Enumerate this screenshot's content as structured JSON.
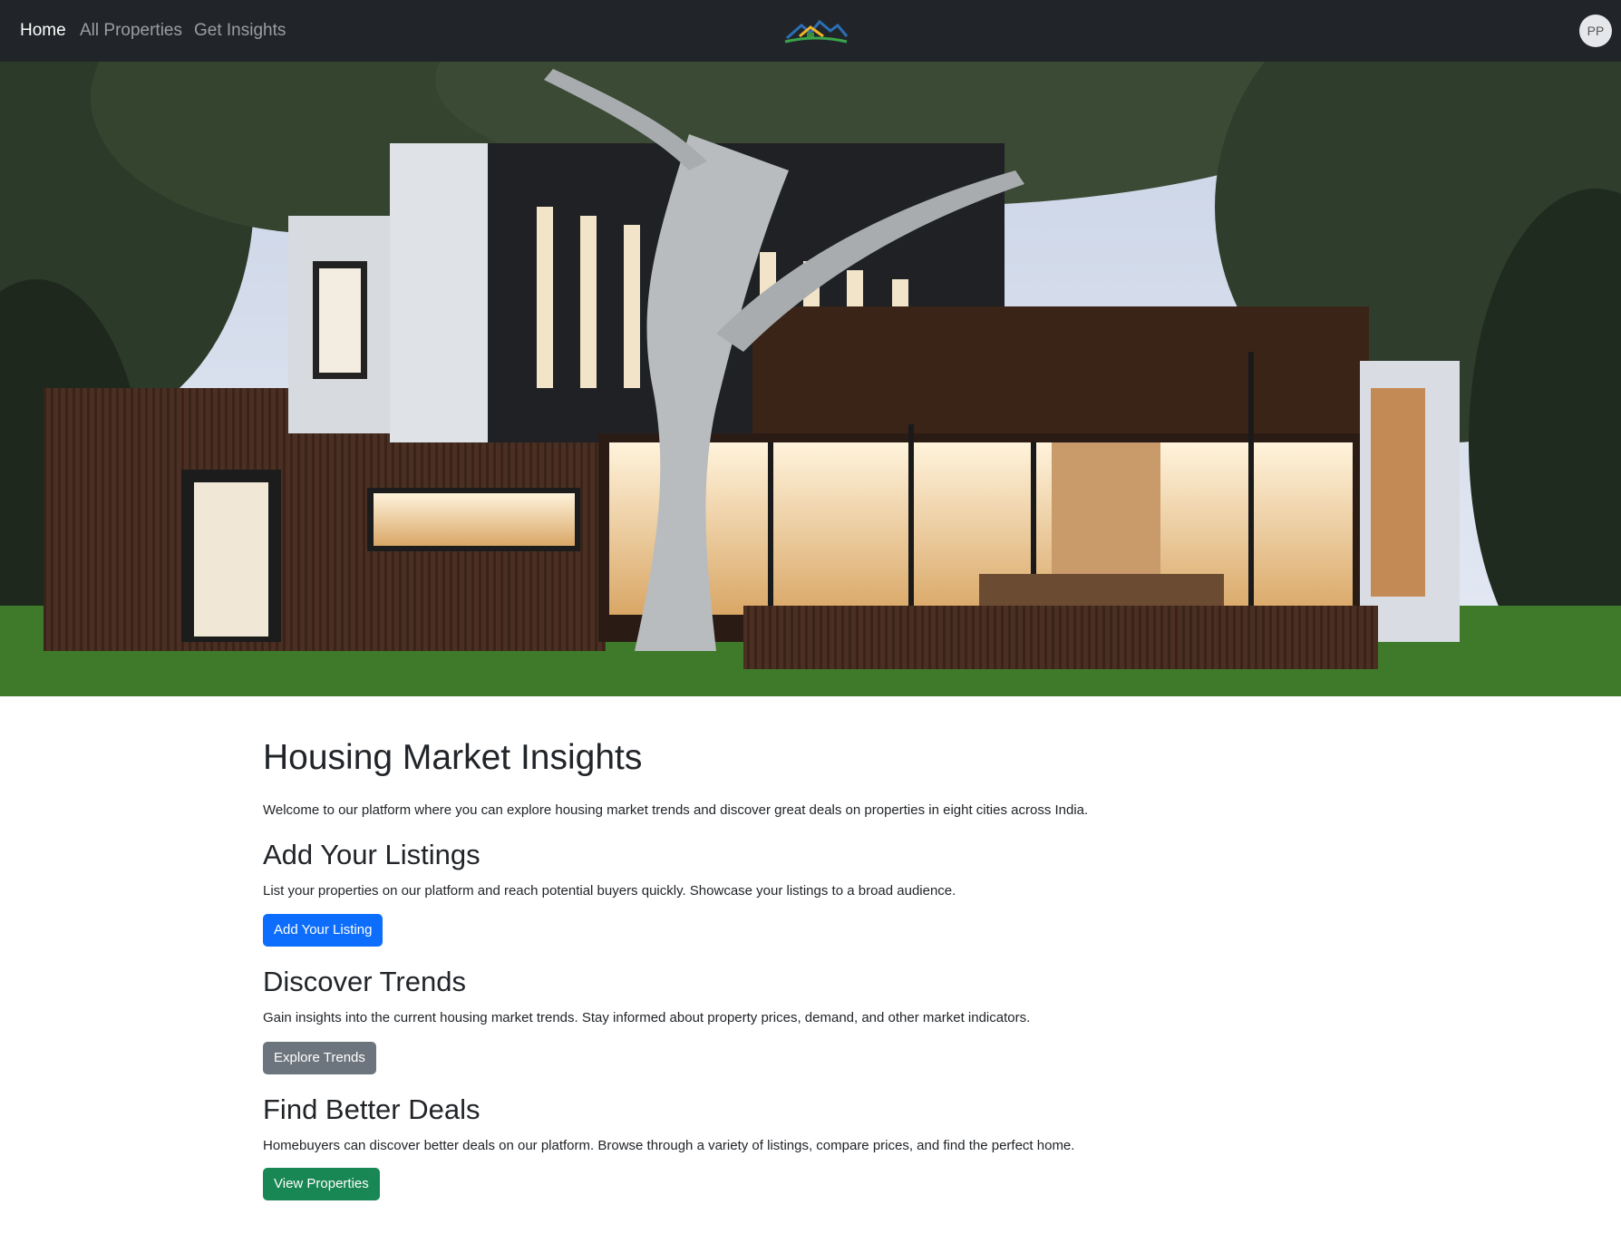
{
  "nav": {
    "links": [
      {
        "label": "Home",
        "active": true
      },
      {
        "label": "All Properties",
        "active": false
      },
      {
        "label": "Get Insights",
        "active": false
      }
    ],
    "logo_icon": "house-mountain-logo",
    "avatar_initials": "PP"
  },
  "hero": {
    "image": "modern-house-photo"
  },
  "main": {
    "title": "Housing Market Insights",
    "intro": "Welcome to our platform where you can explore housing market trends and discover great deals on properties in eight cities across India.",
    "sections": [
      {
        "heading": "Add Your Listings",
        "text": "List your properties on our platform and reach potential buyers quickly. Showcase your listings to a broad audience.",
        "button": "Add Your Listing",
        "button_color": "#0d6efd"
      },
      {
        "heading": "Discover Trends",
        "text": "Gain insights into the current housing market trends. Stay informed about property prices, demand, and other market indicators.",
        "button": "Explore Trends",
        "button_color": "#6c757d"
      },
      {
        "heading": "Find Better Deals",
        "text": "Homebuyers can discover better deals on our platform. Browse through a variety of listings, compare prices, and find the perfect home.",
        "button": "View Properties",
        "button_color": "#198754"
      }
    ]
  },
  "colors": {
    "navbar_bg": "#212529",
    "text": "#212529"
  }
}
